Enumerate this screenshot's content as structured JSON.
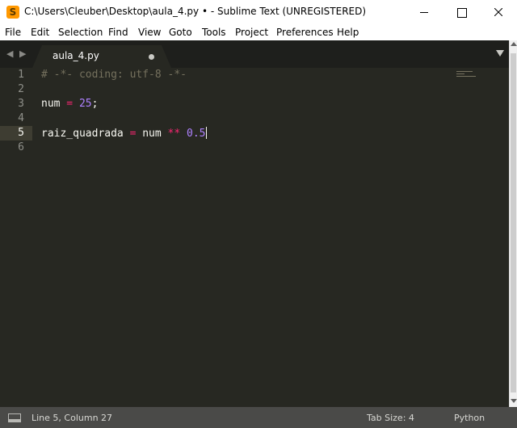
{
  "window": {
    "title": "C:\\Users\\Cleuber\\Desktop\\aula_4.py • - Sublime Text (UNREGISTERED)",
    "app_icon_letter": "S",
    "minimize_icon": "minimize-icon",
    "maximize_icon": "maximize-icon",
    "close_icon": "close-icon"
  },
  "menu": {
    "items": [
      {
        "label": "File"
      },
      {
        "label": "Edit"
      },
      {
        "label": "Selection"
      },
      {
        "label": "Find"
      },
      {
        "label": "View"
      },
      {
        "label": "Goto"
      },
      {
        "label": "Tools"
      },
      {
        "label": "Project"
      },
      {
        "label": "Preferences"
      },
      {
        "label": "Help"
      }
    ]
  },
  "tabs": {
    "nav_arrows": "◀ ▶",
    "active": {
      "label": "aula_4.py",
      "dirty": true
    }
  },
  "editor": {
    "line_numbers": [
      "1",
      "2",
      "3",
      "4",
      "5",
      "6"
    ],
    "active_line": 5,
    "lines": {
      "l1_comment": "# -*- coding: utf-8 -*-",
      "l3_var": "num",
      "l3_eq": " = ",
      "l3_num": "25",
      "l3_semi": ";",
      "l5_var": "raiz_quadrada",
      "l5_eq": " = ",
      "l5_var2": "num",
      "l5_op": " ** ",
      "l5_num": "0.5"
    }
  },
  "status": {
    "position": "Line 5, Column 27",
    "tab_size": "Tab Size: 4",
    "syntax": "Python"
  },
  "colors": {
    "editor_bg": "#272822",
    "comment": "#75715e",
    "operator": "#f92672",
    "number": "#ae81ff",
    "text": "#f8f8f2"
  }
}
